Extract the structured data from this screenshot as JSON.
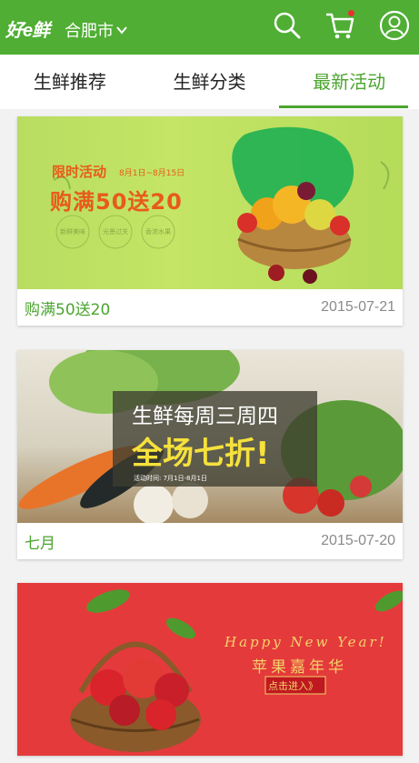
{
  "header": {
    "logo_text": "好e鲜",
    "city": "合肥市",
    "colors": {
      "bar": "#4fae33",
      "badge": "#e8312f"
    },
    "icons": [
      "search-icon",
      "cart-icon",
      "user-icon"
    ]
  },
  "tabs": [
    {
      "label": "生鲜推荐",
      "active": false
    },
    {
      "label": "生鲜分类",
      "active": false
    },
    {
      "label": "最新活动",
      "active": true
    }
  ],
  "cards": [
    {
      "title": "购满50送20",
      "date": "2015-07-21",
      "banner": {
        "headline": "限时活动",
        "dates": "8月1日~8月15日",
        "promo": "购满50送20",
        "badges": [
          "新鲜美味",
          "光景过关",
          "香浓水果"
        ]
      }
    },
    {
      "title": "七月",
      "date": "2015-07-20",
      "banner": {
        "headline": "生鲜每周三周四",
        "promo": "全场七折!",
        "note": "活动时间: 7月1日-8月1日"
      }
    },
    {
      "title": "",
      "date": "",
      "banner": {
        "headline": "Happy New Year!",
        "promo": "苹果嘉年华",
        "button": "点击进入》"
      }
    }
  ]
}
